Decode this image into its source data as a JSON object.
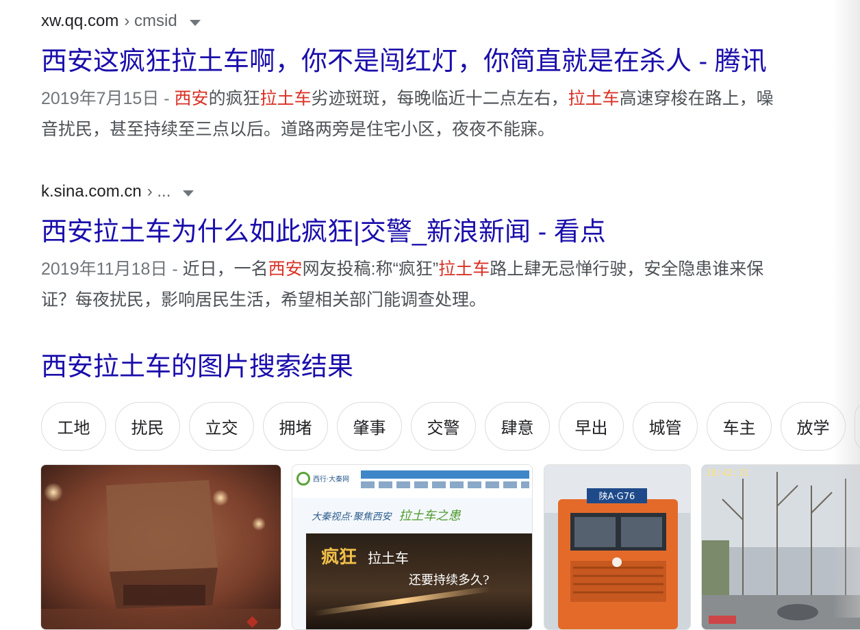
{
  "results": [
    {
      "site": "xw.qq.com",
      "path": "› cmsid",
      "title": "西安这疯狂拉土车啊，你不是闯红灯，你简直就是在杀人 - 腾讯",
      "snippet": {
        "date": "2019年7月15日 - ",
        "line1": [
          {
            "t": "西安",
            "hl": true
          },
          {
            "t": "的疯狂",
            "hl": false
          },
          {
            "t": "拉土车",
            "hl": true
          },
          {
            "t": "劣迹斑斑，每晚临近十二点左右，",
            "hl": false
          },
          {
            "t": "拉土车",
            "hl": true
          },
          {
            "t": "高速穿梭在路上，噪",
            "hl": false
          }
        ],
        "line2": "音扰民，甚至持续至三点以后。道路两旁是住宅小区，夜夜不能寐。"
      }
    },
    {
      "site": "k.sina.com.cn",
      "path": "› ...",
      "title": "西安拉土车为什么如此疯狂|交警_新浪新闻 - 看点",
      "snippet": {
        "date": "2019年11月18日 - ",
        "line1": [
          {
            "t": "近日，一名",
            "hl": false
          },
          {
            "t": "西安",
            "hl": true
          },
          {
            "t": "网友投稿:称“疯狂”",
            "hl": false
          },
          {
            "t": "拉土车",
            "hl": true
          },
          {
            "t": "路上肆无忌惮行驶，安全隐患谁来保",
            "hl": false
          }
        ],
        "line2": "证？每夜扰民，影响居民生活，希望相关部门能调查处理。"
      }
    }
  ],
  "images_heading": "西安拉土车的图片搜索结果",
  "chips": [
    "工地",
    "扰民",
    "立交",
    "拥堵",
    "肇事",
    "交警",
    "肆意",
    "早出",
    "城管",
    "车主",
    "放学"
  ],
  "thumbnails": {
    "t2_logo": "西行·大秦网",
    "t2_caption": "大秦视点·聚焦西安",
    "t2_caption_emph": "拉土车之患",
    "t2_headline_1": "疯狂",
    "t2_headline_2": "拉土车",
    "t2_headline_3": "还要持续多久?",
    "t3_plate": "陕A·G76",
    "t4_timestamp": "18:42:31"
  },
  "colors": {
    "link": "#1a0dab",
    "highlight": "#d93025",
    "snippet_text": "#4d5156",
    "date_text": "#70757a"
  }
}
